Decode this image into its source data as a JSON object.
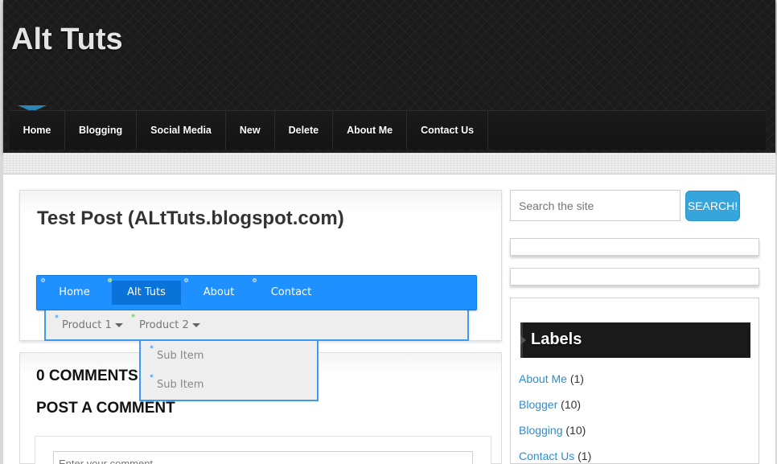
{
  "header": {
    "site_title": "Alt Tuts",
    "nav": [
      "Home",
      "Blogging",
      "Social Media",
      "New",
      "Delete",
      "About Me",
      "Contact Us"
    ],
    "active_nav": "Home"
  },
  "post": {
    "title": "Test Post (ALtTuts.blogspot.com)",
    "demo_menu": {
      "items": [
        "Home",
        "Alt Tuts",
        "About",
        "Contact"
      ],
      "active": "Alt Tuts",
      "submenu": [
        "Product 1",
        "Product 2"
      ],
      "subsubmenu": [
        "Sub Item",
        "Sub Item"
      ]
    }
  },
  "comments": {
    "count_heading": "0 COMMENTS",
    "post_heading": "POST A COMMENT",
    "input_placeholder": "Enter your comment..."
  },
  "sidebar": {
    "search_placeholder": "Search the site",
    "search_button": "SEARCH!",
    "labels_heading": "Labels",
    "labels": [
      {
        "name": "About Me",
        "count": "(1)"
      },
      {
        "name": "Blogger",
        "count": "(10)"
      },
      {
        "name": "Blogging",
        "count": "(10)"
      },
      {
        "name": "Contact Us",
        "count": "(1)"
      }
    ]
  },
  "colors": {
    "accent_blue": "#1e90ff",
    "link_blue": "#2a8fd0",
    "search_button": "#35a5dc",
    "header_bg": "#1b1b1b"
  }
}
